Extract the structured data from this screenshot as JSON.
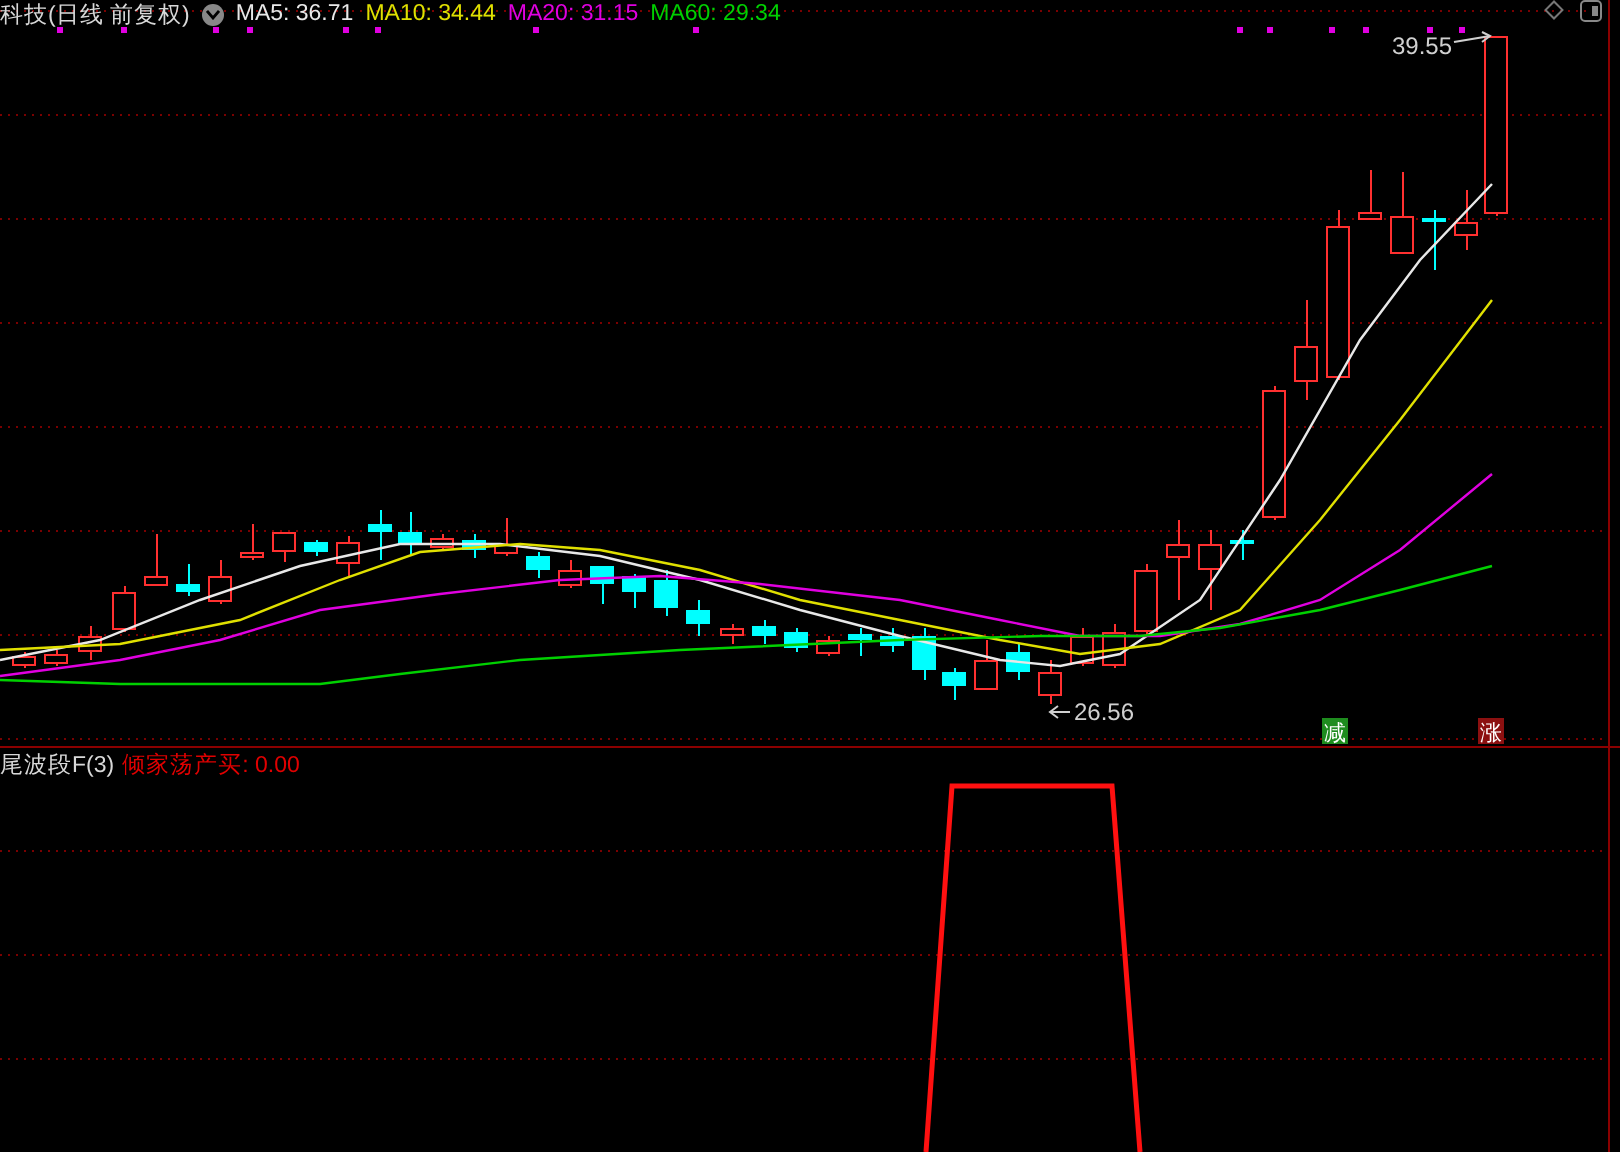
{
  "header": {
    "title": "科技(日线 前复权)",
    "moving_averages": [
      {
        "label": "MA5: 36.71",
        "color": "#e8e8e8"
      },
      {
        "label": "MA10: 34.44",
        "color": "#e0e000"
      },
      {
        "label": "MA20: 31.15",
        "color": "#e000e0"
      },
      {
        "label": "MA60: 29.34",
        "color": "#00d000"
      }
    ]
  },
  "price_chart": {
    "high_label": "39.55",
    "low_label": "26.56",
    "signals": [
      {
        "text": "减",
        "color": "#1e8c1e"
      },
      {
        "text": "涨",
        "color": "#8c1010"
      }
    ]
  },
  "indicator": {
    "name": "尾波段F(3)",
    "value": "倾家荡产买: 0.00"
  }
}
